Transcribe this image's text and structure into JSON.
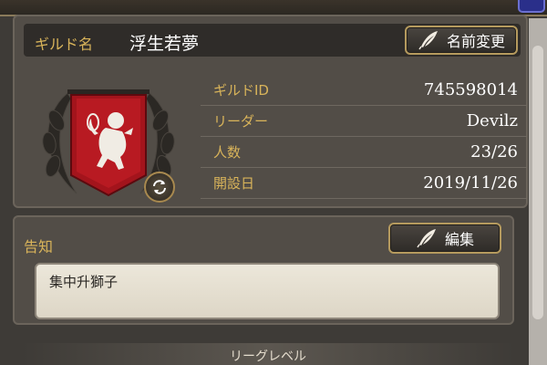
{
  "guild": {
    "name_label": "ギルド名",
    "name": "浮生若夢",
    "rename_button": "名前変更",
    "info": [
      {
        "label": "ギルドID",
        "value": "745598014"
      },
      {
        "label": "リーダー",
        "value": "Devilz"
      },
      {
        "label": "人数",
        "value": "23/26"
      },
      {
        "label": "開設日",
        "value": "2019/11/26"
      }
    ]
  },
  "notice": {
    "title": "告知",
    "edit_button": "編集",
    "text": "集中升獅子"
  },
  "league": {
    "label": "リーグレベル"
  },
  "icons": {
    "quill": "quill-icon",
    "emblem": "lion-banner-emblem",
    "swap": "refresh-icon"
  },
  "colors": {
    "accent_gold": "#d9b45a",
    "panel": "#524d47",
    "banner_red": "#a3141c"
  }
}
